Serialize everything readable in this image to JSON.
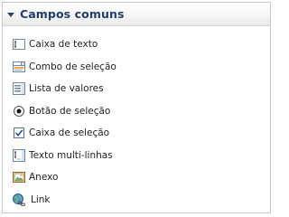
{
  "panel": {
    "title": "Campos comuns",
    "accent_color": "#1f3e6b",
    "items": [
      {
        "label": "Caixa de texto",
        "icon": "text-box-icon"
      },
      {
        "label": "Combo de seleção",
        "icon": "combo-box-icon"
      },
      {
        "label": "Lista de valores",
        "icon": "list-icon"
      },
      {
        "label": "Botão de seleção",
        "icon": "radio-button-icon"
      },
      {
        "label": "Caixa de seleção",
        "icon": "checkbox-icon"
      },
      {
        "label": "Texto multi-linhas",
        "icon": "multiline-text-icon"
      },
      {
        "label": "Anexo",
        "icon": "attachment-icon"
      },
      {
        "label": "Link",
        "icon": "link-icon"
      }
    ]
  }
}
